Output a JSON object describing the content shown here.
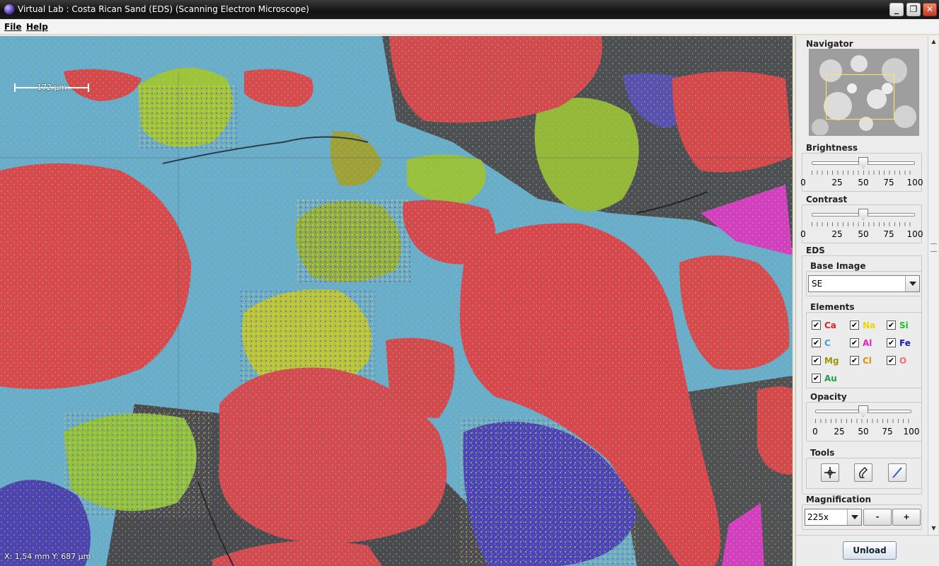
{
  "window": {
    "title": "Virtual Lab : Costa Rican Sand (EDS) (Scanning Electron Microscope)",
    "buttons": {
      "minimize": "_",
      "maximize": "❐",
      "close": "✕"
    }
  },
  "menu": {
    "file": "File",
    "help": "Help"
  },
  "viewport": {
    "scale_label": "172 μm",
    "coords": "X: 1,54 mm  Y: 687 μm"
  },
  "panel": {
    "navigator_title": "Navigator",
    "brightness": {
      "title": "Brightness",
      "value": 50,
      "ticks": [
        "0",
        "25",
        "50",
        "75",
        "100"
      ]
    },
    "contrast": {
      "title": "Contrast",
      "value": 50,
      "ticks": [
        "0",
        "25",
        "50",
        "75",
        "100"
      ]
    },
    "eds_title": "EDS",
    "base_image": {
      "title": "Base Image",
      "selected": "SE"
    },
    "elements_title": "Elements",
    "elements": [
      {
        "label": "Ca",
        "color": "#e02020",
        "checked": true
      },
      {
        "label": "Na",
        "color": "#e8d800",
        "checked": true
      },
      {
        "label": "Si",
        "color": "#20c020",
        "checked": true
      },
      {
        "label": "C",
        "color": "#3aa0e0",
        "checked": true
      },
      {
        "label": "Al",
        "color": "#e020c0",
        "checked": true
      },
      {
        "label": "Fe",
        "color": "#1a1ab0",
        "checked": true
      },
      {
        "label": "Mg",
        "color": "#9a9a00",
        "checked": true
      },
      {
        "label": "Cl",
        "color": "#e09000",
        "checked": true
      },
      {
        "label": "O",
        "color": "#f07070",
        "checked": true
      },
      {
        "label": "Au",
        "color": "#20a040",
        "checked": true
      }
    ],
    "opacity": {
      "title": "Opacity",
      "value": 50,
      "ticks": [
        "0",
        "25",
        "50",
        "75",
        "100"
      ]
    },
    "tools_title": "Tools",
    "tools": [
      {
        "name": "crosshair-tool-icon"
      },
      {
        "name": "pencil-tool-icon"
      },
      {
        "name": "line-tool-icon"
      }
    ],
    "magnification": {
      "title": "Magnification",
      "selected": "225x",
      "minus": "-",
      "plus": "+"
    },
    "unload_label": "Unload"
  }
}
